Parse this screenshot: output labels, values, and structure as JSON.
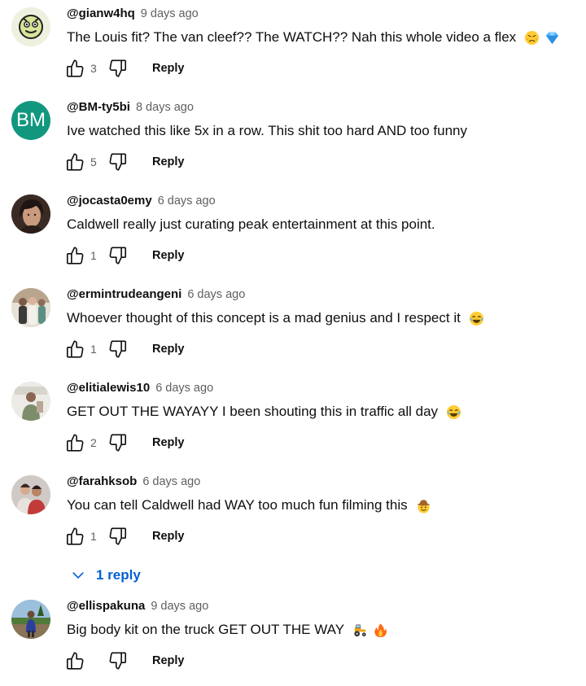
{
  "comments": [
    {
      "author": "@gianw4hq",
      "time": "9 days ago",
      "text": "The Louis fit? The van cleef?? The WATCH?? Nah this whole video a flex",
      "emojis": [
        "persevering-face-emoji",
        "gem-stone-emoji"
      ],
      "likes": "3",
      "reply_label": "Reply",
      "avatar": {
        "kind": "image",
        "bg": "#e9ecd8",
        "icon": "cartoon-face-avatar"
      }
    },
    {
      "author": "@BM-ty5bi",
      "time": "8 days ago",
      "text": "Ive watched this like 5x in a row. This shit too hard AND too funny",
      "emojis": [],
      "likes": "5",
      "reply_label": "Reply",
      "avatar": {
        "kind": "initials",
        "initials": "BM",
        "bg": "#12977f"
      }
    },
    {
      "author": "@jocasta0emy",
      "time": "6 days ago",
      "text": "Caldwell really just curating peak entertainment at this point.",
      "emojis": [],
      "likes": "1",
      "reply_label": "Reply",
      "avatar": {
        "kind": "image",
        "bg": "#6b4a3e",
        "icon": "portrait-photo-avatar"
      }
    },
    {
      "author": "@ermintrudeangeni",
      "time": "6 days ago",
      "text": "Whoever thought of this concept is a mad genius and I respect it",
      "emojis": [
        "tears-of-joy-emoji"
      ],
      "likes": "1",
      "reply_label": "Reply",
      "avatar": {
        "kind": "image",
        "bg": "#c9bfb3",
        "icon": "group-photo-avatar"
      }
    },
    {
      "author": "@elitialewis10",
      "time": "6 days ago",
      "text": "GET OUT THE WAYAYY I been shouting this in traffic all day",
      "emojis": [
        "tears-of-joy-emoji"
      ],
      "likes": "2",
      "reply_label": "Reply",
      "avatar": {
        "kind": "image",
        "bg": "#e6e2da",
        "icon": "person-photo-avatar"
      }
    },
    {
      "author": "@farahksob",
      "time": "6 days ago",
      "text": "You can tell Caldwell had WAY too much fun filming this",
      "emojis": [
        "cowboy-hat-face-emoji"
      ],
      "likes": "1",
      "reply_label": "Reply",
      "replies_label": "1 reply",
      "avatar": {
        "kind": "image",
        "bg": "#d8d4d0",
        "icon": "couple-photo-avatar"
      }
    },
    {
      "author": "@ellispakuna",
      "time": "9 days ago",
      "text": "Big body kit on the truck GET OUT THE WAY",
      "emojis": [
        "tractor-emoji",
        "fire-emoji"
      ],
      "likes": "",
      "reply_label": "Reply",
      "avatar": {
        "kind": "image",
        "bg": "#7fa0b8",
        "icon": "outdoor-photo-avatar"
      }
    }
  ],
  "colors": {
    "text_primary": "#0f0f0f",
    "text_secondary": "#606060",
    "link_blue": "#065fd4"
  }
}
